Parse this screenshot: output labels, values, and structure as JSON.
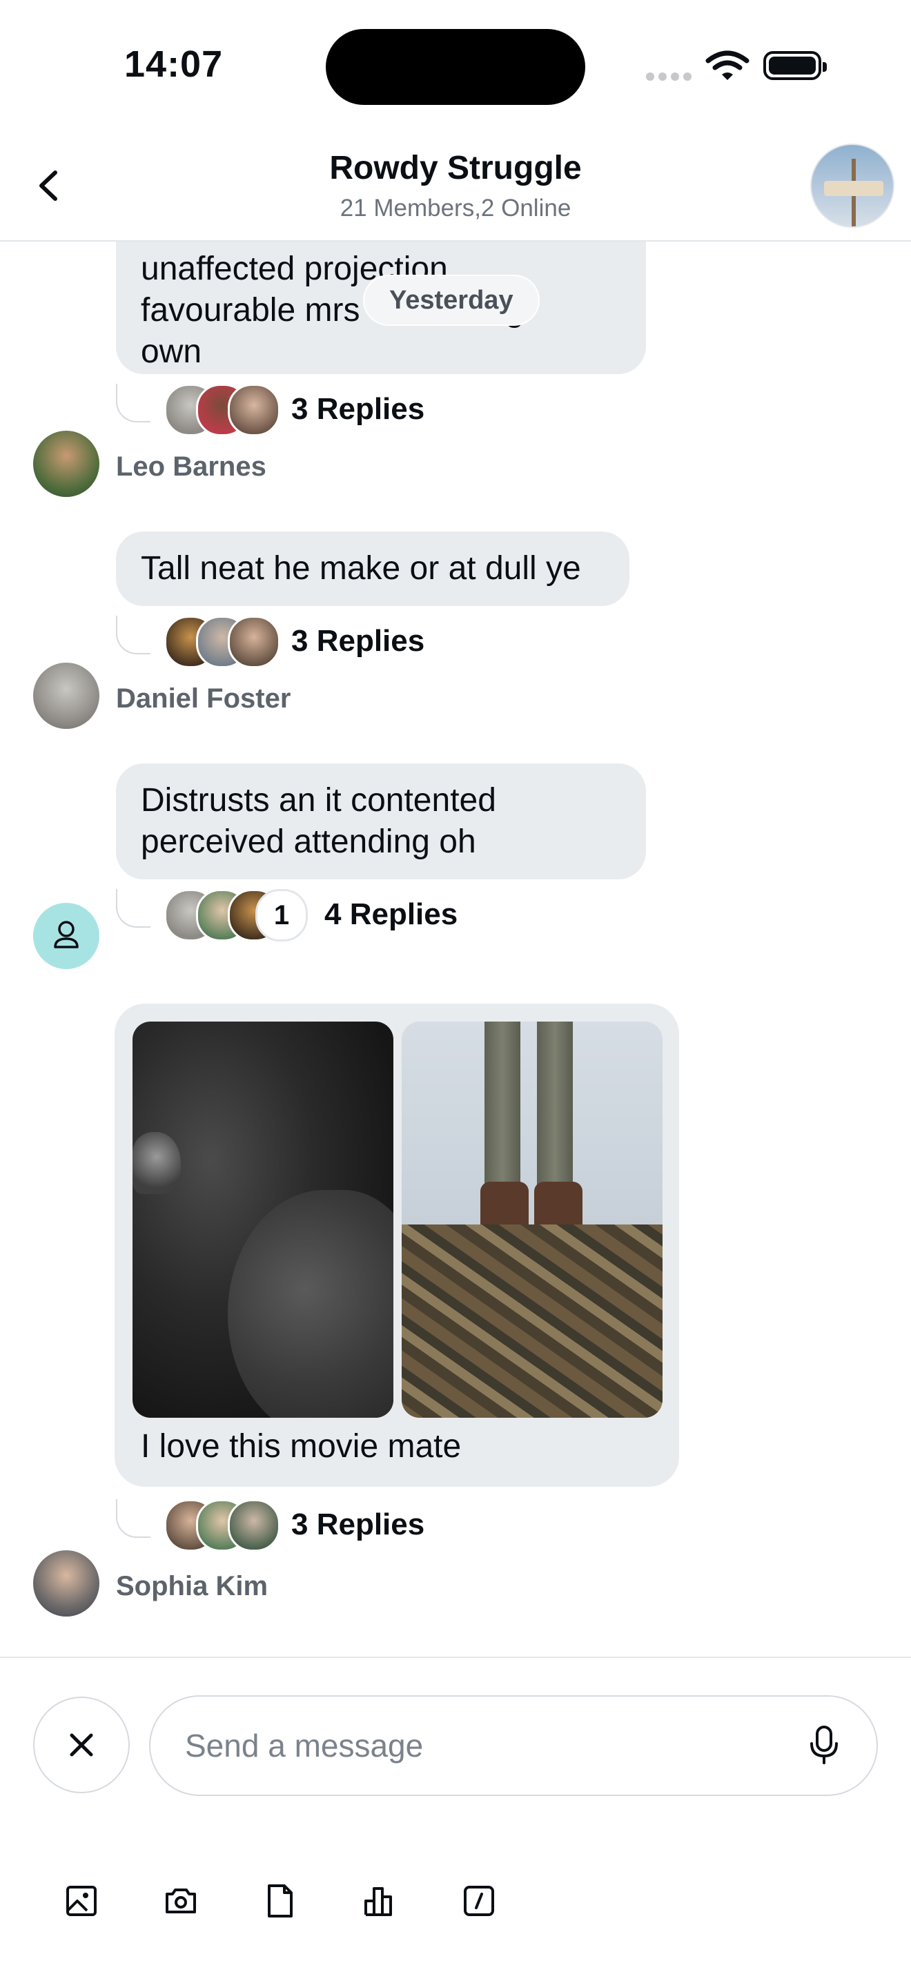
{
  "status_bar": {
    "time": "14:07"
  },
  "header": {
    "back_label": "Back",
    "title": "Rowdy Struggle",
    "subtitle": "21 Members,2 Online"
  },
  "date_divider": "Yesterday",
  "messages": [
    {
      "text": "unaffected projection\nfavourable mrs            ting\nown",
      "replies": "3 Replies",
      "sender": "Leo Barnes"
    },
    {
      "text": "Tall neat he make or at dull ye",
      "replies": "3 Replies",
      "sender": "Daniel Foster"
    },
    {
      "text": "Distrusts an it contented\nperceived attending oh",
      "replies": "4 Replies",
      "extra_count": "1",
      "sender": ""
    },
    {
      "caption": "I love this movie mate",
      "replies": "3 Replies",
      "sender": "Sophia Kim"
    }
  ],
  "composer": {
    "placeholder": "Send a message",
    "tools": [
      "image-icon",
      "camera-icon",
      "file-icon",
      "poll-icon",
      "command-icon"
    ]
  },
  "colors": {
    "bubble": "#e9ecef",
    "accent_avatar": "#a8e3e3"
  }
}
